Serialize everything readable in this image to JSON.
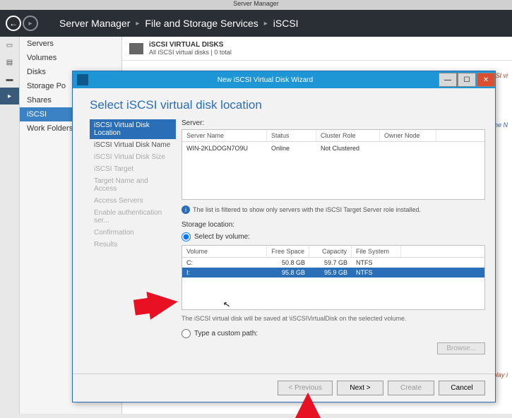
{
  "app_title": "Server Manager",
  "breadcrumb": {
    "a": "Server Manager",
    "b": "File and Storage Services",
    "c": "iSCSI"
  },
  "sidebar": {
    "items": [
      {
        "label": "Servers"
      },
      {
        "label": "Volumes"
      },
      {
        "label": "Disks"
      },
      {
        "label": "Storage Po"
      },
      {
        "label": "Shares"
      },
      {
        "label": "iSCSI"
      },
      {
        "label": "Work Folders"
      }
    ]
  },
  "content": {
    "section_title": "iSCSI VIRTUAL DISKS",
    "section_sub": "All iSCSI virtual disks | 0 total",
    "note_right1": "There are no iSCSI vi",
    "note_right2": "disk, start the N",
    "note_right3": "VHD to display i"
  },
  "wizard": {
    "title": "New iSCSI Virtual Disk Wizard",
    "heading": "Select iSCSI virtual disk location",
    "steps": [
      "iSCSI Virtual Disk Location",
      "iSCSI Virtual Disk Name",
      "iSCSI Virtual Disk Size",
      "iSCSI Target",
      "Target Name and Access",
      "Access Servers",
      "Enable authentication ser...",
      "Confirmation",
      "Results"
    ],
    "server_label": "Server:",
    "server_headers": {
      "name": "Server Name",
      "status": "Status",
      "role": "Cluster Role",
      "owner": "Owner Node"
    },
    "server_row": {
      "name": "WIN-2KLDOGN7O9U",
      "status": "Online",
      "role": "Not Clustered",
      "owner": ""
    },
    "filter_note": "The list is filtered to show only servers with the iSCSI Target Server role installed.",
    "storage_label": "Storage location:",
    "radio_volume": "Select by volume:",
    "vol_headers": {
      "vol": "Volume",
      "free": "Free Space",
      "cap": "Capacity",
      "fs": "File System"
    },
    "vol_rows": [
      {
        "vol": "C:",
        "free": "50.8 GB",
        "cap": "59.7 GB",
        "fs": "NTFS"
      },
      {
        "vol": "I:",
        "free": "95.8 GB",
        "cap": "95.9 GB",
        "fs": "NTFS"
      }
    ],
    "save_note": "The iSCSI virtual disk will be saved at \\iSCSIVirtualDisk on the selected volume.",
    "radio_custom": "Type a custom path:",
    "browse": "Browse...",
    "buttons": {
      "prev": "< Previous",
      "next": "Next >",
      "create": "Create",
      "cancel": "Cancel"
    }
  }
}
